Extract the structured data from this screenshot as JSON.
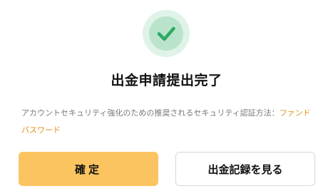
{
  "dialog": {
    "title": "出金申請提出完了",
    "message_text": "アカウントセキュリティ強化のための推奨されるセキュリティ認証方法：",
    "message_link": "ファンドパスワード",
    "icon": "check-icon"
  },
  "buttons": {
    "confirm_label": "確定",
    "history_label": "出金記録を見る"
  },
  "colors": {
    "accent": "#fcc461",
    "link": "#e0901a",
    "success": "#2eaa62",
    "success_bg": "#dff3e8"
  }
}
